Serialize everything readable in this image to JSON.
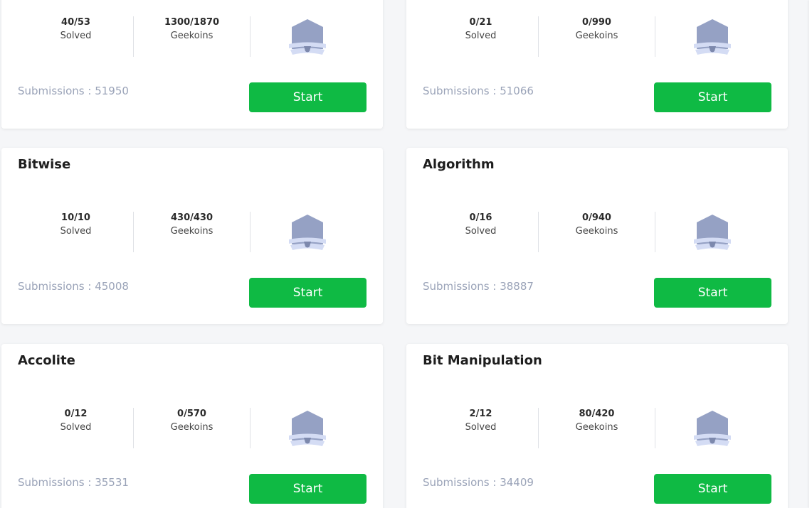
{
  "cards": [
    {
      "title": "",
      "solved": "40/53",
      "solved_label": "Solved",
      "geekoins": "1300/1870",
      "geekoins_label": "Geekoins",
      "submissions": "Submissions : 51950",
      "button": "Start"
    },
    {
      "title": "",
      "solved": "0/21",
      "solved_label": "Solved",
      "geekoins": "0/990",
      "geekoins_label": "Geekoins",
      "submissions": "Submissions : 51066",
      "button": "Start"
    },
    {
      "title": "Bitwise",
      "solved": "10/10",
      "solved_label": "Solved",
      "geekoins": "430/430",
      "geekoins_label": "Geekoins",
      "submissions": "Submissions : 45008",
      "button": "Start"
    },
    {
      "title": "Algorithm",
      "solved": "0/16",
      "solved_label": "Solved",
      "geekoins": "0/940",
      "geekoins_label": "Geekoins",
      "submissions": "Submissions : 38887",
      "button": "Start"
    },
    {
      "title": "Accolite",
      "solved": "0/12",
      "solved_label": "Solved",
      "geekoins": "0/570",
      "geekoins_label": "Geekoins",
      "submissions": "Submissions : 35531",
      "button": "Start"
    },
    {
      "title": "Bit Manipulation",
      "solved": "2/12",
      "solved_label": "Solved",
      "geekoins": "80/420",
      "geekoins_label": "Geekoins",
      "submissions": "Submissions : 34409",
      "button": "Start"
    }
  ],
  "icons": {
    "badge": "badge-icon"
  },
  "colors": {
    "accent": "#0fba44",
    "badge": "#95a1c4",
    "ribbon": "#d4dcf4",
    "muted_text": "#9aa3b8"
  }
}
